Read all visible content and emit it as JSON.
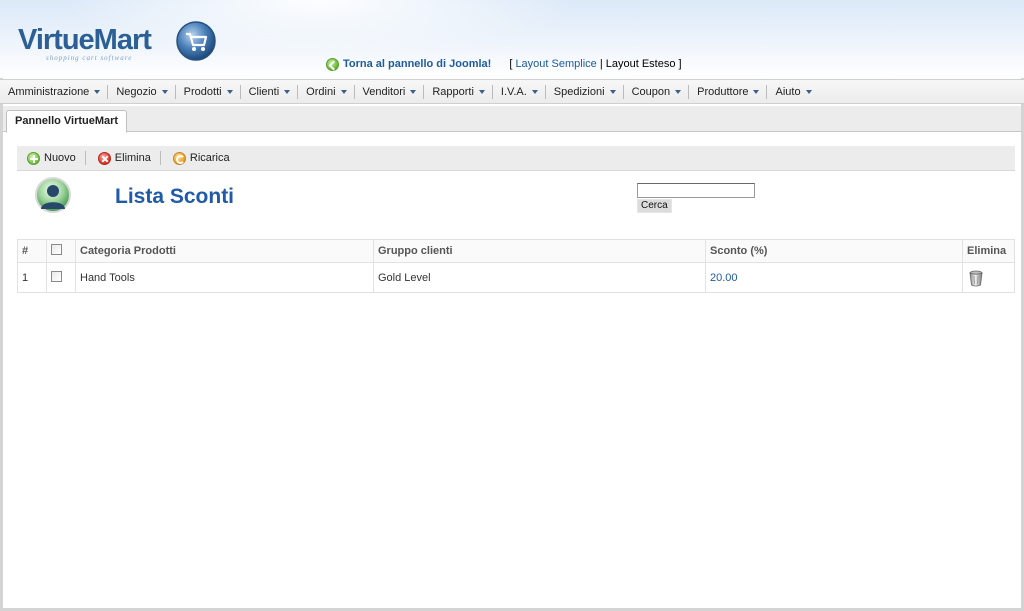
{
  "brand": {
    "name": "VirtueMart",
    "tagline": "shopping cart software"
  },
  "header": {
    "joomla_link": "Torna al pannello di Joomla!",
    "layout_open": "[",
    "layout_simple": "Layout Semplice",
    "layout_sep": "|",
    "layout_extended": "Layout Esteso",
    "layout_close": "]"
  },
  "menu": [
    {
      "label": "Amministrazione"
    },
    {
      "label": "Negozio"
    },
    {
      "label": "Prodotti"
    },
    {
      "label": "Clienti"
    },
    {
      "label": "Ordini"
    },
    {
      "label": "Venditori"
    },
    {
      "label": "Rapporti"
    },
    {
      "label": "I.V.A."
    },
    {
      "label": "Spedizioni"
    },
    {
      "label": "Coupon"
    },
    {
      "label": "Produttore"
    },
    {
      "label": "Aiuto"
    }
  ],
  "tab": {
    "label": "Pannello VirtueMart"
  },
  "toolbar": {
    "new_label": "Nuovo",
    "delete_label": "Elimina",
    "reload_label": "Ricarica"
  },
  "page": {
    "title": "Lista Sconti",
    "search_value": "",
    "search_button": "Cerca"
  },
  "table": {
    "headers": {
      "num": "#",
      "category": "Categoria Prodotti",
      "group": "Gruppo clienti",
      "discount": "Sconto (%)",
      "delete": "Elimina"
    },
    "rows": [
      {
        "num": "1",
        "category": "Hand Tools",
        "group": "Gold Level",
        "discount": "20.00"
      }
    ]
  },
  "colors": {
    "title": "#1f5ba8",
    "link": "#1d5b9e",
    "menubar": "#ececec"
  },
  "icons": {
    "logo": "cart-globe-icon",
    "joomla": "check-circle-icon",
    "new": "plus-circle-icon",
    "delete": "x-circle-icon",
    "reload": "refresh-circle-icon",
    "title": "user-group-icon",
    "row_delete": "trash-icon"
  }
}
